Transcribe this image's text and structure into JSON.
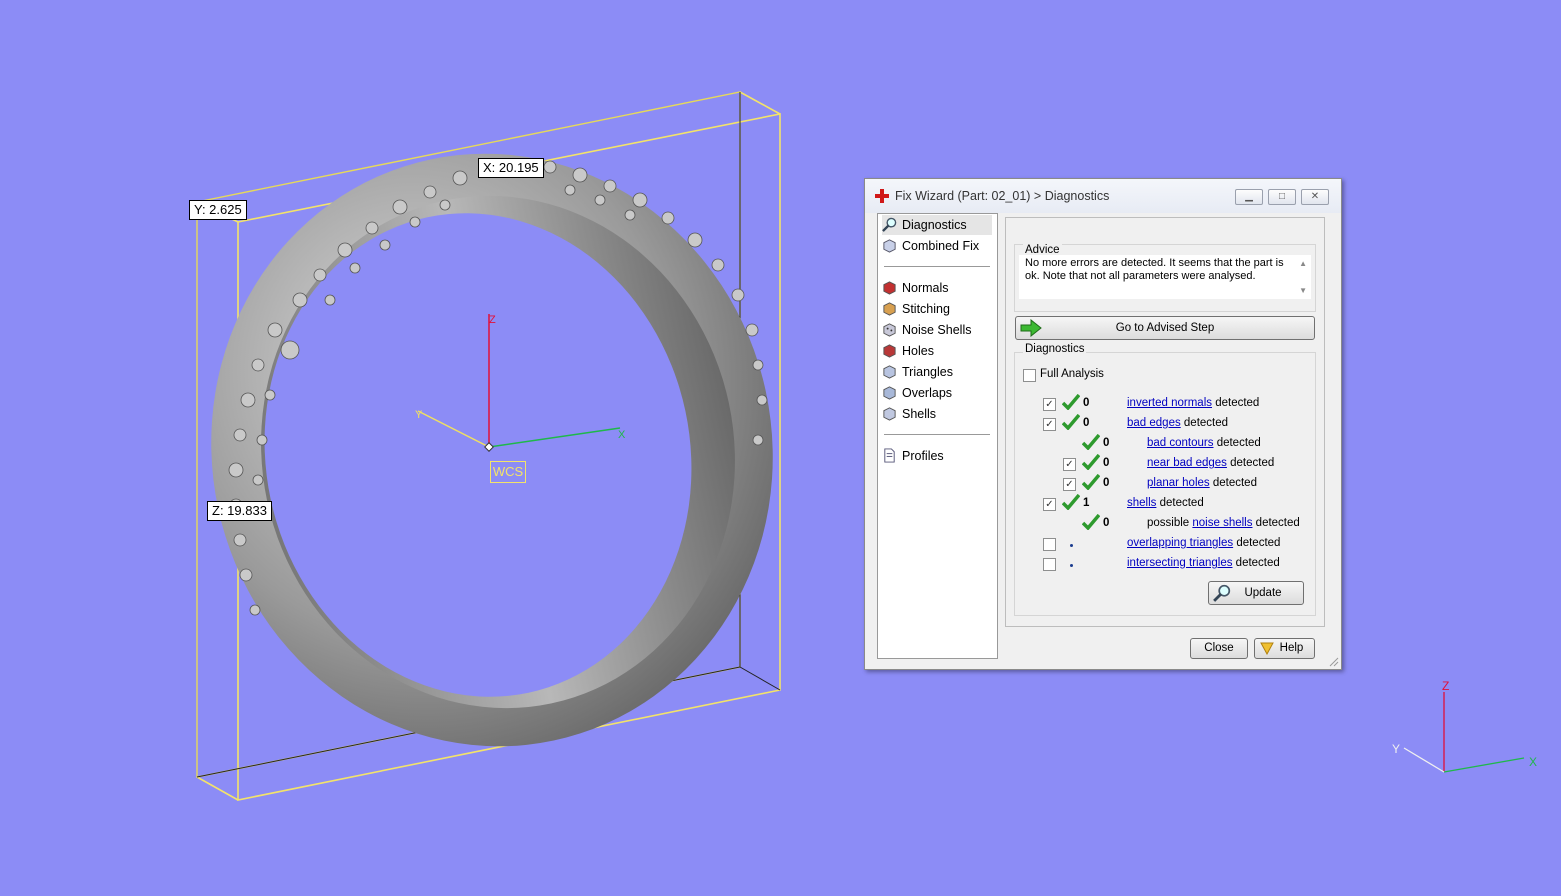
{
  "viewport": {
    "background": "#8c8cf6",
    "dimensions": {
      "x_label": "X: 20.195",
      "y_label": "Y: 2.625",
      "z_label": "Z: 19.833"
    },
    "wcs_label": "WCS",
    "axes": {
      "x": "X",
      "y": "Y",
      "z": "Z"
    },
    "corner_axes": {
      "x": "X",
      "y": "Y",
      "z": "Z"
    }
  },
  "dialog": {
    "title": "Fix Wizard (Part: 02_01) > Diagnostics",
    "nav": {
      "top": [
        {
          "label": "Diagnostics",
          "icon": "magnifier-icon"
        },
        {
          "label": "Combined Fix",
          "icon": "cube-icon"
        }
      ],
      "steps": [
        {
          "label": "Normals",
          "icon": "normals-icon"
        },
        {
          "label": "Stitching",
          "icon": "stitching-icon"
        },
        {
          "label": "Noise Shells",
          "icon": "noise-shells-icon"
        },
        {
          "label": "Holes",
          "icon": "holes-icon"
        },
        {
          "label": "Triangles",
          "icon": "triangles-icon"
        },
        {
          "label": "Overlaps",
          "icon": "overlaps-icon"
        },
        {
          "label": "Shells",
          "icon": "shells-icon"
        }
      ],
      "bottom": [
        {
          "label": "Profiles",
          "icon": "document-icon"
        }
      ]
    },
    "advice": {
      "title": "Advice",
      "text": "No more errors are detected. It seems that the part is ok. Note that not all parameters were analysed."
    },
    "go_button": "Go to Advised Step",
    "diagnostics": {
      "title": "Diagnostics",
      "full_analysis": "Full Analysis",
      "rows": [
        {
          "count": "0",
          "link": "inverted normals",
          "suffix": " detected"
        },
        {
          "count": "0",
          "link": "bad edges",
          "suffix": " detected"
        },
        {
          "count": "0",
          "link": "bad contours",
          "suffix": " detected"
        },
        {
          "count": "0",
          "link": "near bad edges",
          "suffix": " detected"
        },
        {
          "count": "0",
          "link": "planar holes",
          "suffix": " detected"
        },
        {
          "count": "1",
          "link": "shells",
          "suffix": " detected"
        },
        {
          "count": "0",
          "prefix": "possible ",
          "link": "noise shells",
          "suffix": " detected"
        },
        {
          "link": "overlapping triangles",
          "suffix": " detected"
        },
        {
          "link": "intersecting triangles",
          "suffix": " detected"
        }
      ],
      "update_button": "Update"
    },
    "close_button": "Close",
    "help_button": "Help"
  }
}
